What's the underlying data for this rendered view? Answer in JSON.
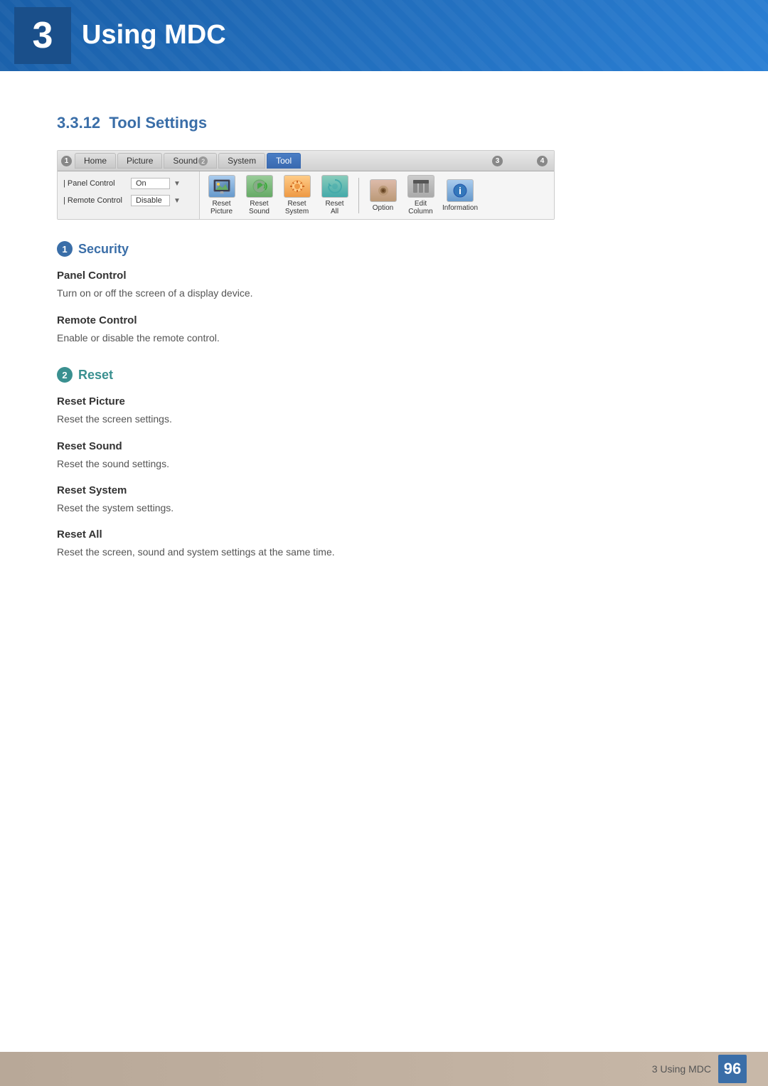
{
  "header": {
    "chapter_number": "3",
    "title": "Using MDC"
  },
  "section": {
    "number": "3.3.12",
    "title": "Tool Settings"
  },
  "ui": {
    "tabs": [
      {
        "label": "Home",
        "active": false,
        "number": null
      },
      {
        "label": "Picture",
        "active": false,
        "number": null
      },
      {
        "label": "Sound",
        "active": false,
        "number": "2"
      },
      {
        "label": "System",
        "active": false,
        "number": null
      },
      {
        "label": "Tool",
        "active": true,
        "number": null
      }
    ],
    "left_panel": {
      "rows": [
        {
          "label": "Panel Control",
          "value": "On"
        },
        {
          "label": "Remote Control",
          "value": "Disable"
        }
      ]
    },
    "tools": [
      {
        "label": "Reset\nPicture",
        "icon": "picture"
      },
      {
        "label": "Reset\nSound",
        "icon": "sound"
      },
      {
        "label": "Reset\nSystem",
        "icon": "system"
      },
      {
        "label": "Reset\nAll",
        "icon": "all"
      }
    ],
    "right_tools": [
      {
        "label": "Option",
        "icon": "option"
      },
      {
        "label": "Edit\nColumn",
        "icon": "edit"
      },
      {
        "label": "Information",
        "icon": "info"
      }
    ],
    "badge_numbers": [
      "3",
      "4"
    ]
  },
  "sections": [
    {
      "badge": "1",
      "badge_color": "blue",
      "heading": "Security",
      "subsections": [
        {
          "title": "Panel Control",
          "description": "Turn on or off the screen of a display device."
        },
        {
          "title": "Remote Control",
          "description": "Enable or disable the remote control."
        }
      ]
    },
    {
      "badge": "2",
      "badge_color": "teal",
      "heading": "Reset",
      "subsections": [
        {
          "title": "Reset Picture",
          "description": "Reset the screen settings."
        },
        {
          "title": "Reset Sound",
          "description": "Reset the sound settings."
        },
        {
          "title": "Reset System",
          "description": "Reset the system settings."
        },
        {
          "title": "Reset All",
          "description": "Reset the screen, sound and system settings at the same time."
        }
      ]
    }
  ],
  "footer": {
    "text": "3 Using MDC",
    "page": "96"
  }
}
